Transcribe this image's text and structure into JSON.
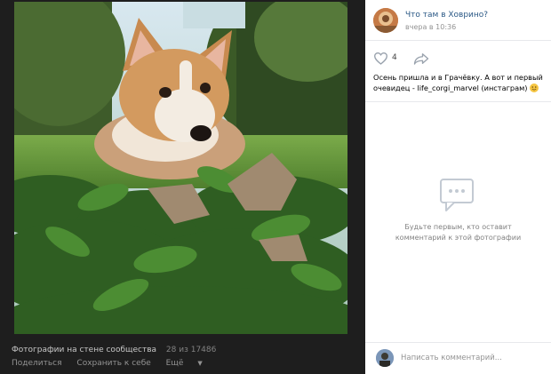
{
  "photo_footer": {
    "album_title": "Фотографии на стене сообщества",
    "photo_counter": "28 из 17486",
    "actions": {
      "share": "Поделиться",
      "save": "Сохранить к себе",
      "more": "Ещё"
    }
  },
  "post": {
    "author_name": "Что там в Ховрино?",
    "timestamp": "вчера в 10:36",
    "likes": "4",
    "caption": "Осень пришла и в Грачёвку. А вот и первый очевидец - life_corgi_marvel (инстаграм)"
  },
  "comments": {
    "empty_text": "Будьте первым, кто оставит комментарий к этой фотографии",
    "input_placeholder": "Написать комментарий..."
  },
  "icons": {
    "like": "heart-icon",
    "share": "share-arrow-icon",
    "empty": "comments-bubble-icon",
    "emoji": "smile-emoji-icon",
    "more": "chevron-down-icon"
  },
  "colors": {
    "link": "#2a5885",
    "muted": "#939393",
    "dark_bg": "#1e1e1e"
  }
}
